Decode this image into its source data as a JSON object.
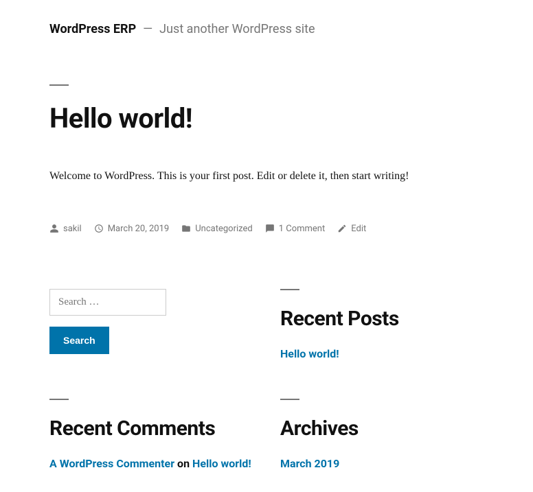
{
  "header": {
    "site_title": "WordPress ERP",
    "tagline": "Just another WordPress site"
  },
  "post": {
    "title": "Hello world!",
    "content": "Welcome to WordPress. This is your first post. Edit or delete it, then start writing!",
    "meta": {
      "author": "sakil",
      "date": "March 20, 2019",
      "category": "Uncategorized",
      "comments": "1 Comment",
      "edit": "Edit"
    }
  },
  "widgets": {
    "search": {
      "placeholder": "Search …",
      "button": "Search"
    },
    "recent_posts": {
      "title": "Recent Posts",
      "items": [
        "Hello world!"
      ]
    },
    "recent_comments": {
      "title": "Recent Comments",
      "items": [
        {
          "author": "A WordPress Commenter",
          "on": "on",
          "post": "Hello world!"
        }
      ]
    },
    "archives": {
      "title": "Archives",
      "items": [
        "March 2019"
      ]
    }
  }
}
